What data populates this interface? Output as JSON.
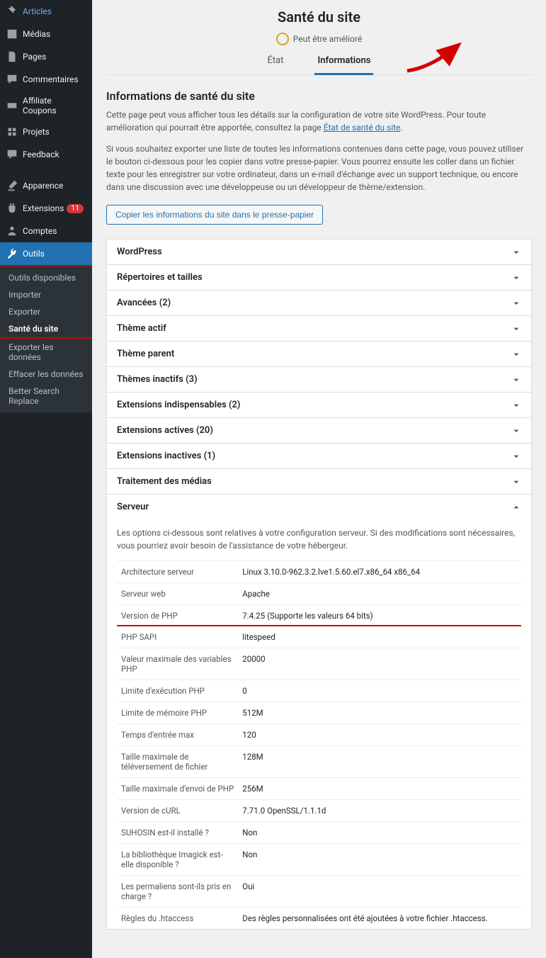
{
  "sidebar": {
    "items": [
      {
        "icon": "pin",
        "label": "Articles"
      },
      {
        "icon": "media",
        "label": "Médias"
      },
      {
        "icon": "page",
        "label": "Pages"
      },
      {
        "icon": "comment",
        "label": "Commentaires"
      },
      {
        "icon": "ticket",
        "label": "Affiliate Coupons"
      },
      {
        "icon": "projects",
        "label": "Projets"
      },
      {
        "icon": "feedback",
        "label": "Feedback"
      },
      {
        "icon": "brush",
        "label": "Apparence"
      },
      {
        "icon": "plugin",
        "label": "Extensions",
        "badge": "11"
      },
      {
        "icon": "users",
        "label": "Comptes"
      },
      {
        "icon": "tools",
        "label": "Outils",
        "current": true
      }
    ],
    "submenu": [
      {
        "label": "Outils disponibles"
      },
      {
        "label": "Importer"
      },
      {
        "label": "Exporter"
      },
      {
        "label": "Santé du site",
        "current": true
      },
      {
        "label": "Exporter les données"
      },
      {
        "label": "Effacer les données"
      },
      {
        "label": "Better Search Replace"
      }
    ]
  },
  "page": {
    "title": "Santé du site",
    "status_text": "Peut être amélioré",
    "tabs": {
      "status": "État",
      "info": "Informations"
    },
    "heading": "Informations de santé du site",
    "intro1_a": "Cette page peut vous afficher tous les détails sur la configuration de votre site WordPress. Pour toute amélioration qui pourrait être apportée, consultez la page ",
    "intro1_link": "État de santé du site",
    "intro1_b": ".",
    "intro2": "Si vous souhaitez exporter une liste de toutes les informations contenues dans cette page, vous pouvez utiliser le bouton ci-dessous pour les copier dans votre presse-papier. Vous pourrez ensuite les coller dans un fichier texte pour les enregistrer sur votre ordinateur, dans un e-mail d'échange avec un support technique, ou encore dans une discussion avec une développeuse ou un développeur de thème/extension.",
    "copy_btn": "Copier les informations du site dans le presse-papier"
  },
  "accordion": [
    {
      "title": "WordPress"
    },
    {
      "title": "Répertoires et tailles"
    },
    {
      "title": "Avancées (2)"
    },
    {
      "title": "Thème actif"
    },
    {
      "title": "Thème parent"
    },
    {
      "title": "Thèmes inactifs (3)"
    },
    {
      "title": "Extensions indispensables (2)"
    },
    {
      "title": "Extensions actives (20)"
    },
    {
      "title": "Extensions inactives (1)"
    },
    {
      "title": "Traitement des médias"
    }
  ],
  "server": {
    "title": "Serveur",
    "desc": "Les options ci-dessous sont relatives à votre configuration serveur. Si des modifications sont nécessaires, vous pourriez avoir besoin de l'assistance de votre hébergeur.",
    "rows": [
      {
        "k": "Architecture serveur",
        "v": "Linux 3.10.0-962.3.2.lve1.5.60.el7.x86_64 x86_64"
      },
      {
        "k": "Serveur web",
        "v": "Apache"
      },
      {
        "k": "Version de PHP",
        "v": "7.4.25 (Supporte les valeurs 64 bits)",
        "hl": true
      },
      {
        "k": "PHP SAPI",
        "v": "litespeed"
      },
      {
        "k": "Valeur maximale des variables PHP",
        "v": "20000"
      },
      {
        "k": "Limite d'exécution PHP",
        "v": "0"
      },
      {
        "k": "Limite de mémoire PHP",
        "v": "512M"
      },
      {
        "k": "Temps d'entrée max",
        "v": "120"
      },
      {
        "k": "Taille maximale de téléversement de fichier",
        "v": "128M"
      },
      {
        "k": "Taille maximale d'envoi de PHP",
        "v": "256M"
      },
      {
        "k": "Version de cURL",
        "v": "7.71.0 OpenSSL/1.1.1d"
      },
      {
        "k": "SUHOSIN est-il installé ?",
        "v": "Non"
      },
      {
        "k": "La bibliothèque Imagick est-elle disponible ?",
        "v": "Non"
      },
      {
        "k": "Les permaliens sont-ils pris en charge ?",
        "v": "Oui"
      },
      {
        "k": "Règles du .htaccess",
        "v": "Des règles personnalisées ont été ajoutées à votre fichier .htaccess."
      }
    ]
  }
}
